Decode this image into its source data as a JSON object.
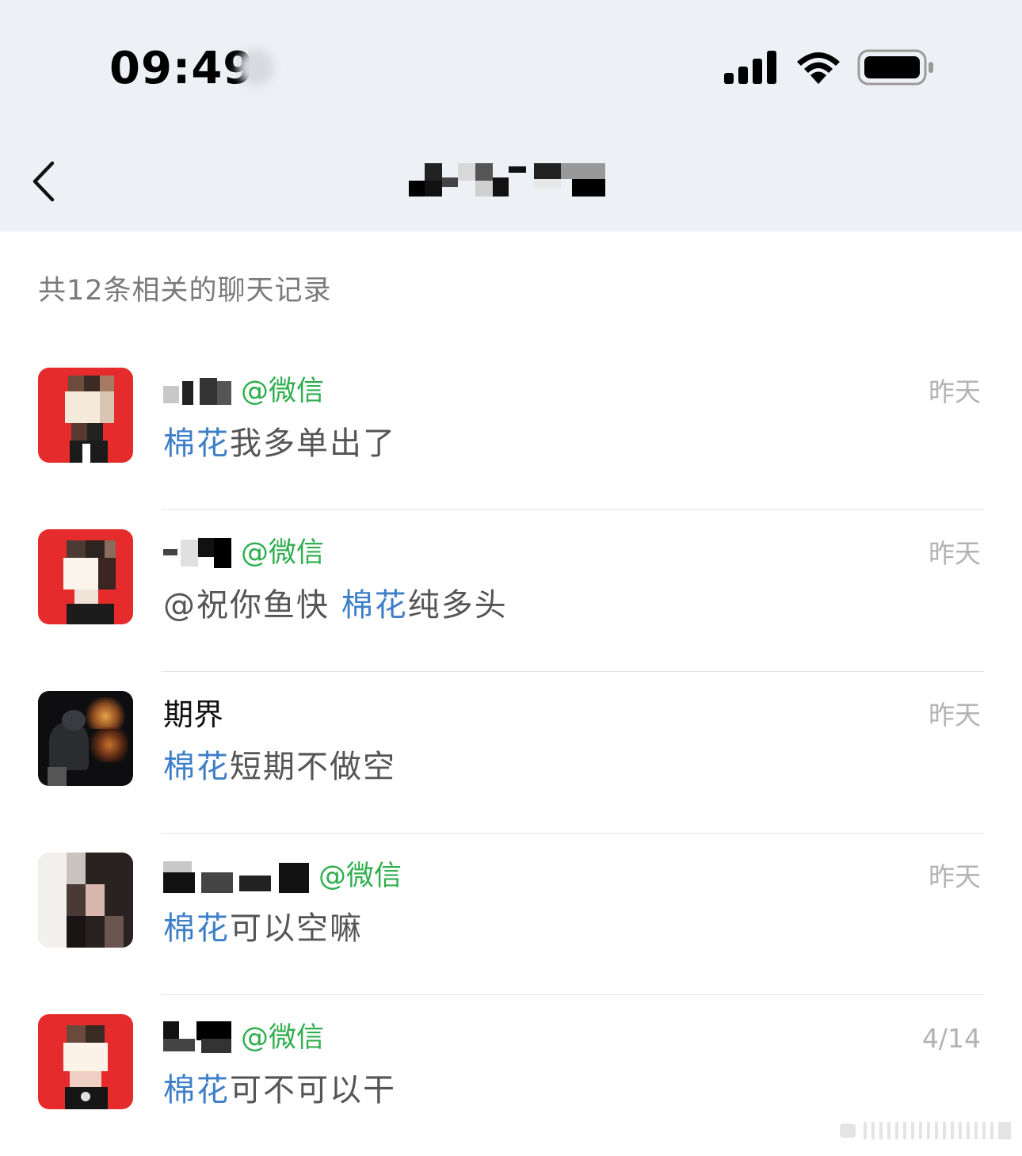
{
  "status_bar": {
    "time": "09:49",
    "signal_icon": "cellular-signal-icon",
    "wifi_icon": "wifi-icon",
    "battery_icon": "battery-icon"
  },
  "nav": {
    "back_icon": "chevron-left-icon",
    "title": ""
  },
  "summary": {
    "count_text": "共12条相关的聊天记录"
  },
  "results": [
    {
      "sender": "",
      "source": "@微信",
      "time": "昨天",
      "keyword": "棉花",
      "prefix": "",
      "message": "我多单出了",
      "avatar": "red-cartoon-avatar"
    },
    {
      "sender": "",
      "source": "@微信",
      "time": "昨天",
      "keyword": "棉花",
      "prefix": "@祝你鱼快 ",
      "message": "纯多头",
      "avatar": "red-cartoon-avatar"
    },
    {
      "sender": "期界",
      "source": "",
      "time": "昨天",
      "keyword": "棉花",
      "prefix": "",
      "message": "短期不做空",
      "avatar": "dark-flame-avatar"
    },
    {
      "sender": "",
      "source": "@微信",
      "time": "昨天",
      "keyword": "棉花",
      "prefix": "",
      "message": "可以空嘛",
      "avatar": "photo-avatar"
    },
    {
      "sender": "",
      "source": "@微信",
      "time": "4/14",
      "keyword": "棉花",
      "prefix": "",
      "message": "可不可以干",
      "avatar": "red-cartoon-avatar"
    }
  ],
  "colors": {
    "header_bg": "#edf0f4",
    "keyword": "#3f7fc8",
    "source_tag": "#2fae4e",
    "timestamp": "#b3b3b3",
    "summary_text": "#7a7a7a"
  }
}
